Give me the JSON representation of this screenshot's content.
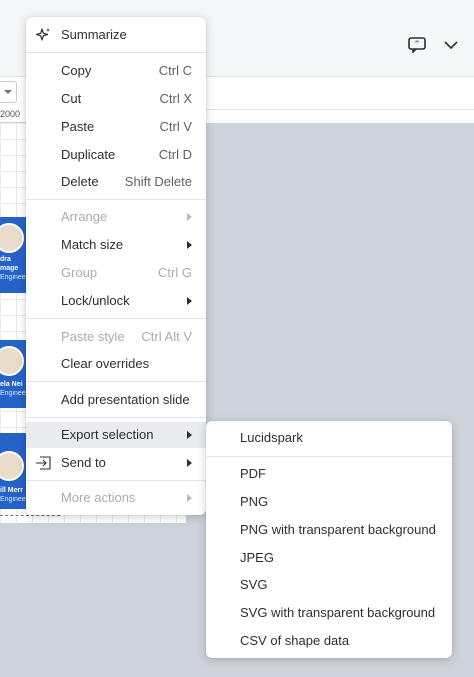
{
  "context_menu": {
    "summarize": "Summarize",
    "copy": {
      "label": "Copy",
      "shortcut": "Ctrl C"
    },
    "cut": {
      "label": "Cut",
      "shortcut": "Ctrl X"
    },
    "paste": {
      "label": "Paste",
      "shortcut": "Ctrl V"
    },
    "duplicate": {
      "label": "Duplicate",
      "shortcut": "Ctrl D"
    },
    "delete": {
      "label": "Delete",
      "shortcut": "Shift Delete"
    },
    "arrange": "Arrange",
    "match_size": "Match size",
    "group": {
      "label": "Group",
      "shortcut": "Ctrl G"
    },
    "lock_unlock": "Lock/unlock",
    "paste_style": {
      "label": "Paste style",
      "shortcut": "Ctrl Alt V"
    },
    "clear_overrides": "Clear overrides",
    "add_presentation_slide": "Add presentation slide",
    "export_selection": "Export selection",
    "send_to": "Send to",
    "more_actions": "More actions"
  },
  "export_submenu": {
    "items": [
      "Lucidspark",
      "PDF",
      "PNG",
      "PNG with transparent background",
      "JPEG",
      "SVG",
      "SVG with transparent background",
      "CSV of shape data"
    ]
  },
  "canvas": {
    "ruler_label": "2000",
    "cards": [
      {
        "name": "dra",
        "name2": "mage",
        "role": "Engineer"
      },
      {
        "name": "ela Nei",
        "role": "Engineer"
      },
      {
        "name": "ill Merr",
        "role": "Engineer"
      }
    ]
  },
  "colors": {
    "menu_background": "#ffffff",
    "highlight": "#e9ebef",
    "disabled_text": "#a7acb3",
    "canvas_grey": "#ced3db",
    "card_blue": "#2563c9"
  }
}
